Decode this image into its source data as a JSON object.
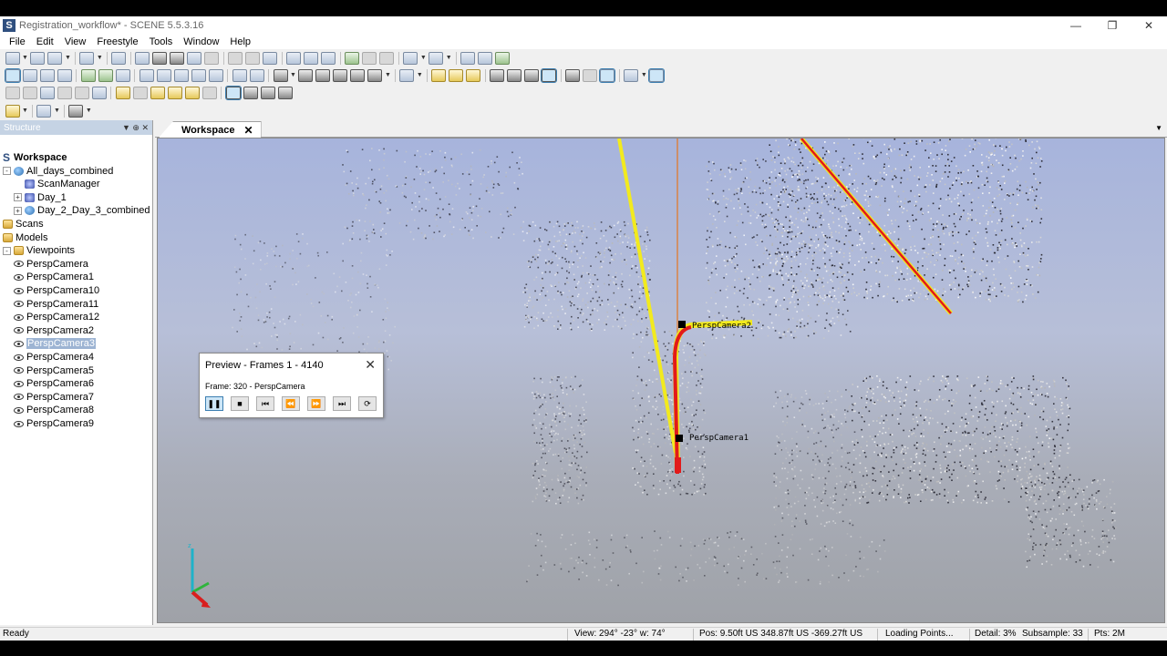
{
  "window": {
    "title": "Registration_workflow* - SCENE 5.5.3.16",
    "app_icon": "S",
    "controls": [
      "minimize-icon",
      "restore-icon",
      "close-icon"
    ]
  },
  "menu": [
    "File",
    "Edit",
    "View",
    "Freestyle",
    "Tools",
    "Window",
    "Help"
  ],
  "structure": {
    "header": "Structure",
    "items": [
      {
        "label": "Workspace",
        "depth": 0,
        "icon": "workspace-icon",
        "bold": true
      },
      {
        "label": "All_days_combined",
        "depth": 0,
        "icon": "project-icon",
        "expander": "-"
      },
      {
        "label": "ScanManager",
        "depth": 2,
        "icon": "scan-manager-icon"
      },
      {
        "label": "Day_1",
        "depth": 1,
        "icon": "scan-icon",
        "expander": "+"
      },
      {
        "label": "Day_2_Day_3_combined",
        "depth": 1,
        "icon": "project-icon",
        "expander": "+"
      },
      {
        "label": "Scans",
        "depth": 0,
        "icon": "folder-icon"
      },
      {
        "label": "Models",
        "depth": 0,
        "icon": "folder-icon"
      },
      {
        "label": "Viewpoints",
        "depth": 0,
        "icon": "folder-icon",
        "expander": "-"
      },
      {
        "label": "PerspCamera",
        "depth": 1,
        "icon": "camera-icon"
      },
      {
        "label": "PerspCamera1",
        "depth": 1,
        "icon": "camera-icon"
      },
      {
        "label": "PerspCamera10",
        "depth": 1,
        "icon": "camera-icon"
      },
      {
        "label": "PerspCamera11",
        "depth": 1,
        "icon": "camera-icon"
      },
      {
        "label": "PerspCamera12",
        "depth": 1,
        "icon": "camera-icon"
      },
      {
        "label": "PerspCamera2",
        "depth": 1,
        "icon": "camera-icon"
      },
      {
        "label": "PerspCamera3",
        "depth": 1,
        "icon": "camera-icon",
        "selected": true
      },
      {
        "label": "PerspCamera4",
        "depth": 1,
        "icon": "camera-icon"
      },
      {
        "label": "PerspCamera5",
        "depth": 1,
        "icon": "camera-icon"
      },
      {
        "label": "PerspCamera6",
        "depth": 1,
        "icon": "camera-icon"
      },
      {
        "label": "PerspCamera7",
        "depth": 1,
        "icon": "camera-icon"
      },
      {
        "label": "PerspCamera8",
        "depth": 1,
        "icon": "camera-icon"
      },
      {
        "label": "PerspCamera9",
        "depth": 1,
        "icon": "camera-icon"
      }
    ]
  },
  "workspace_tab": {
    "label": "Workspace"
  },
  "viewport": {
    "labels": [
      "PerspCamera2",
      "PerspCamera1"
    ],
    "path_colors": {
      "yellow": "#f2ea1e",
      "red": "#e21a1a",
      "orange": "#e07a2e"
    }
  },
  "preview": {
    "title": "Preview - Frames 1 - 4140",
    "frame_info": "Frame: 320  -  PerspCamera",
    "buttons": [
      "pause-icon",
      "stop-icon",
      "skip-to-start-icon",
      "rewind-icon",
      "fast-forward-icon",
      "skip-to-end-icon",
      "loop-icon"
    ]
  },
  "status": {
    "ready": "Ready",
    "view": "View: 294° -23° w: 74°",
    "pos": "Pos: 9.50ft US 348.87ft US -369.27ft US",
    "loading": "Loading Points...",
    "detail": "Detail: 3%",
    "subsample": "Subsample: 33",
    "pts": "Pts: 2M"
  }
}
